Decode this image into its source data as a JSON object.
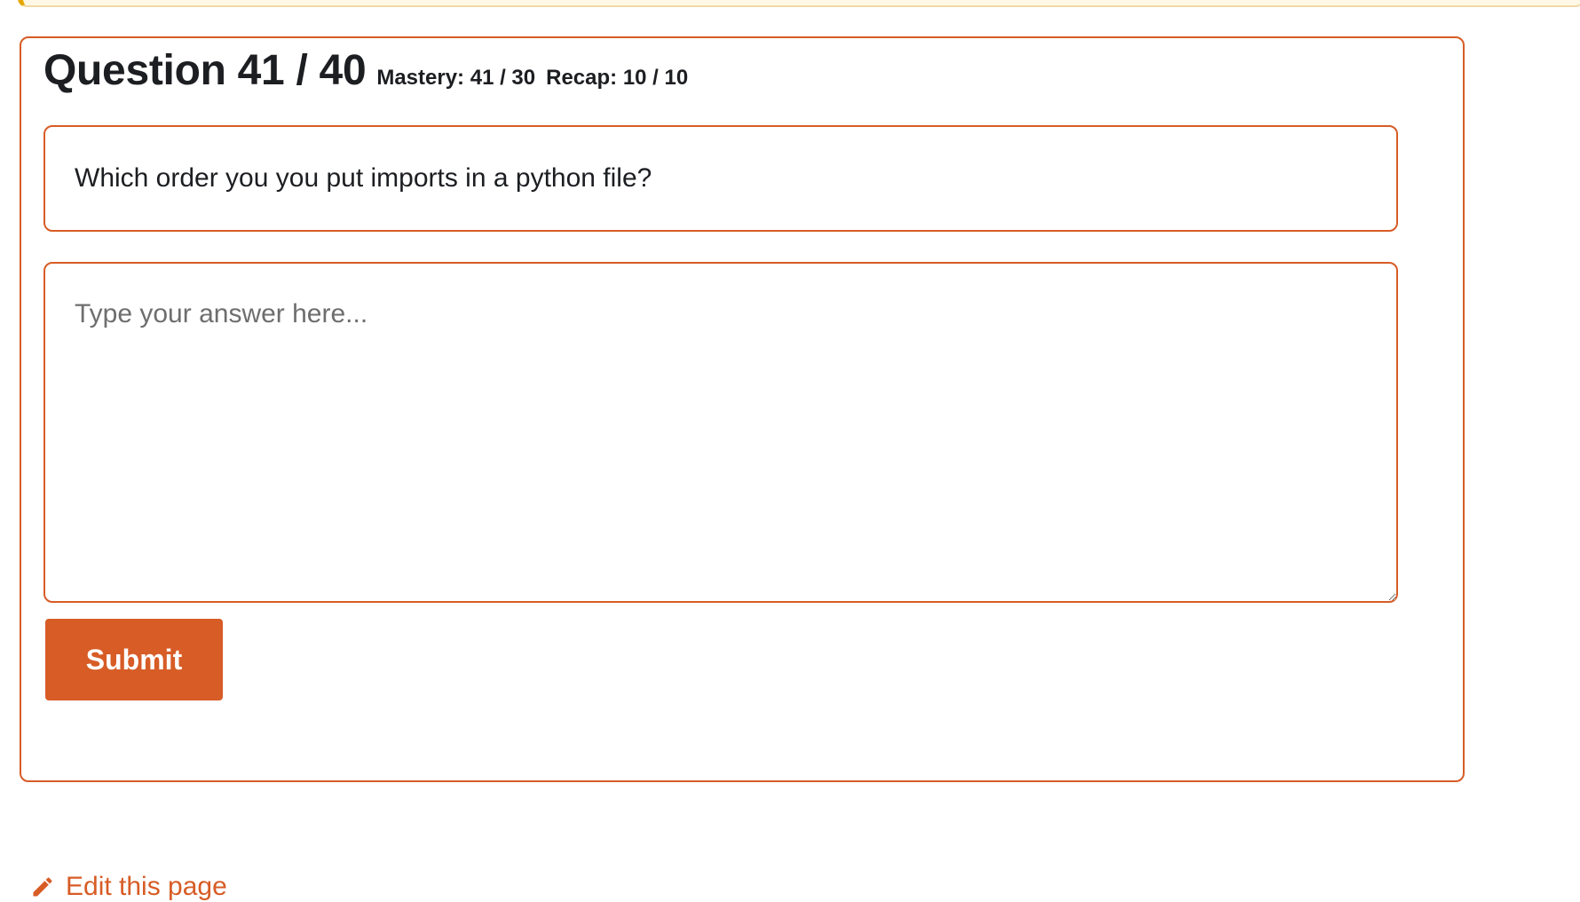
{
  "quiz": {
    "title": "Question 41 / 40",
    "mastery": "Mastery: 41 / 30",
    "recap": "Recap: 10 / 10",
    "question_text": "Which order you you put imports in a python file?",
    "answer_value": "",
    "answer_placeholder": "Type your answer here...",
    "submit_label": "Submit"
  },
  "footer": {
    "edit_link_label": "Edit this page",
    "edit_icon": "pencil-icon"
  },
  "colors": {
    "accent": "#d75c26",
    "banner_background": "#fff8e6",
    "banner_border": "#e6a700",
    "text": "#1c1e21"
  }
}
